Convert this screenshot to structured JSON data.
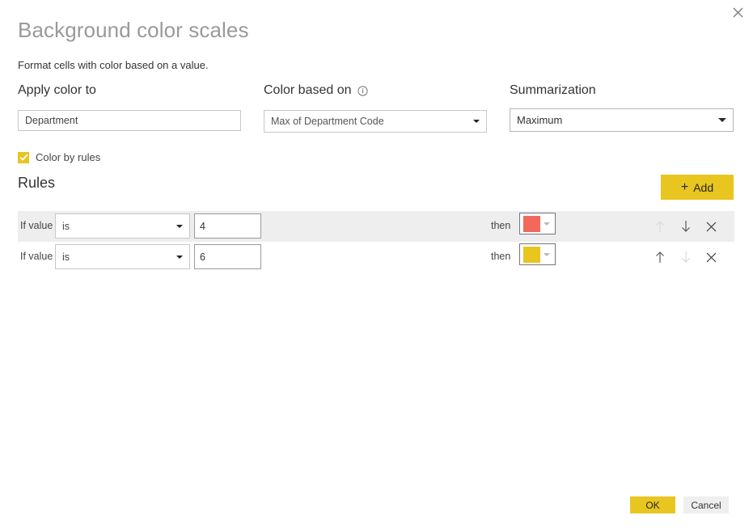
{
  "dialog": {
    "title": "Background color scales",
    "subtitle": "Format cells with color based on a value.",
    "close_icon": "close-icon"
  },
  "fields": {
    "apply_color_to": {
      "label": "Apply color to",
      "value": "Department"
    },
    "color_based_on": {
      "label": "Color based on",
      "info_icon": "info-icon",
      "value": "Max of Department Code"
    },
    "summarization": {
      "label": "Summarization",
      "value": "Maximum"
    }
  },
  "color_by_rules": {
    "label": "Color by rules",
    "checked": true,
    "check_color": "#e8c51f"
  },
  "rules_section": {
    "title": "Rules",
    "add_label": "Add",
    "add_plus": "+",
    "if_label": "If value",
    "then_label": "then",
    "rules": [
      {
        "operator": "is",
        "value": "4",
        "color": "#f2695c",
        "highlighted": true,
        "up_enabled": false,
        "down_enabled": true
      },
      {
        "operator": "is",
        "value": "6",
        "color": "#e8c51f",
        "highlighted": false,
        "up_enabled": true,
        "down_enabled": false
      }
    ]
  },
  "footer": {
    "ok_label": "OK",
    "cancel_label": "Cancel",
    "ok_color": "#e8c51f"
  }
}
